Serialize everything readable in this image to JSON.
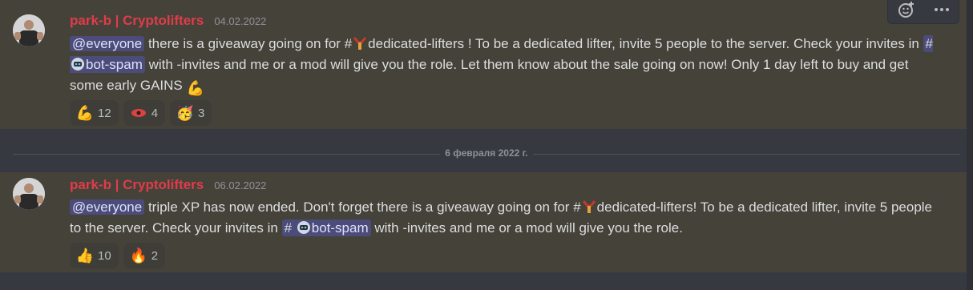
{
  "toolbar": {
    "add_reaction_icon": "add-reaction-icon",
    "more_icon": "more-icon"
  },
  "messages": [
    {
      "author": "park-b | Cryptolifters",
      "timestamp": "04.02.2022",
      "mention": "@everyone",
      "text_1": "there is a giveaway going on for #",
      "channel_1": "dedicated-lifters",
      "text_2": " ! To be a dedicated lifter, invite 5 people to the server. Check your invites in ",
      "channel_2": "bot-spam",
      "text_3": " with -invites and me or a mod will give you the role. Let them know about the sale going on now! Only 1 day left to buy and get some early GAINS ",
      "reactions": [
        {
          "emoji": "💪",
          "count": "12"
        },
        {
          "emoji": "custom-shaker",
          "count": "4"
        },
        {
          "emoji": "🥳",
          "count": "3"
        }
      ]
    },
    {
      "author": "park-b | Cryptolifters",
      "timestamp": "06.02.2022",
      "mention": "@everyone",
      "text_1": " triple XP has now ended. Don't forget there is a giveaway going on for #",
      "channel_1": "dedicated-lifters",
      "text_2": "! To be a dedicated lifter, invite 5 people to the server. Check your invites in ",
      "channel_2": "bot-spam",
      "text_3": "  with -invites and me or a mod will give you the role.",
      "reactions": [
        {
          "emoji": "👍",
          "count": "10"
        },
        {
          "emoji": "🔥",
          "count": "2"
        }
      ]
    }
  ],
  "divider": {
    "label": "6 февраля 2022 г."
  },
  "colors": {
    "author": "#e03c48",
    "mention_bg": "#4b4c7a",
    "highlight_bg": "#45423a"
  }
}
